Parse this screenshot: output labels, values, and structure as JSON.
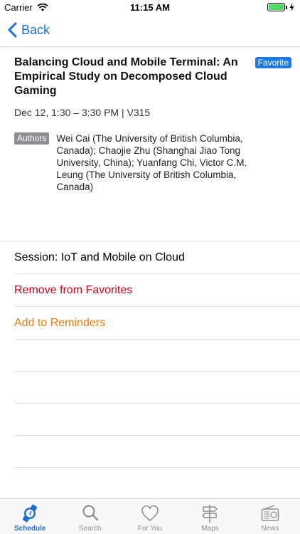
{
  "status_bar": {
    "carrier": "Carrier",
    "time": "11:15 AM",
    "battery_level": 1.0
  },
  "nav": {
    "back_label": "Back"
  },
  "paper": {
    "title": "Balancing Cloud and Mobile Terminal: An Empirical Study on Decomposed Cloud Gaming",
    "favorite_badge": "Favorite",
    "time_location": "Dec 12, 1:30 – 3:30 PM | V315",
    "authors_tag": "Authors",
    "authors": "Wei Cai (The University of British Columbia, Canada); Chaojie Zhu (Shanghai Jiao Tong University, China); Yuanfang Chi, Victor C.M. Leung (The University of British Columbia, Canada)"
  },
  "actions": {
    "session": "Session: IoT and Mobile on Cloud",
    "remove_favorites": "Remove from Favorites",
    "add_reminders": "Add to Reminders"
  },
  "colors": {
    "accent": "#1e6ed6",
    "remove": "#d0021b",
    "reminder": "#ea7b11",
    "authors_tag": "#8e8e93"
  },
  "tabs": [
    {
      "label": "Schedule",
      "icon": "watch-icon",
      "active": true
    },
    {
      "label": "Search",
      "icon": "search-icon",
      "active": false
    },
    {
      "label": "For You",
      "icon": "heart-icon",
      "active": false
    },
    {
      "label": "Maps",
      "icon": "signpost-icon",
      "active": false
    },
    {
      "label": "News",
      "icon": "radio-icon",
      "active": false
    }
  ]
}
